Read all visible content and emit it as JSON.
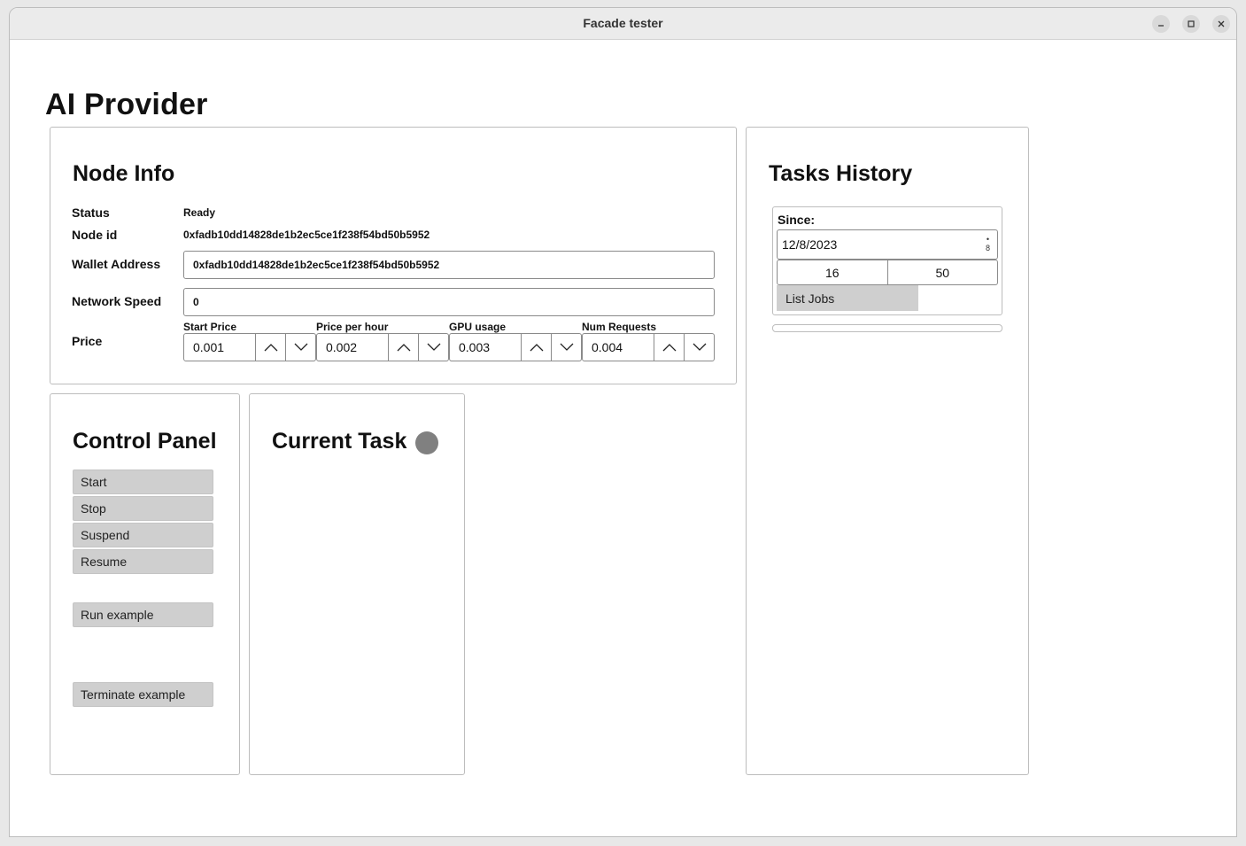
{
  "window": {
    "title": "Facade tester"
  },
  "app": {
    "title": "AI Provider"
  },
  "node_info": {
    "heading": "Node Info",
    "status_label": "Status",
    "status_value": "Ready",
    "node_id_label": "Node id",
    "node_id_value": "0xfadb10dd14828de1b2ec5ce1f238f54bd50b5952",
    "wallet_label": "Wallet Address",
    "wallet_value": "0xfadb10dd14828de1b2ec5ce1f238f54bd50b5952",
    "network_label": "Network Speed",
    "network_value": "0",
    "price_label": "Price",
    "prices": [
      {
        "label": "Start Price",
        "value": "0.001"
      },
      {
        "label": "Price per hour",
        "value": "0.002"
      },
      {
        "label": "GPU usage",
        "value": "0.003"
      },
      {
        "label": "Num Requests",
        "value": "0.004"
      }
    ]
  },
  "control_panel": {
    "heading": "Control Panel",
    "start": "Start",
    "stop": "Stop",
    "suspend": "Suspend",
    "resume": "Resume",
    "run_example": "Run example",
    "terminate_example": "Terminate example"
  },
  "current_task": {
    "heading": "Current Task",
    "indicator_color": "#808080"
  },
  "tasks_history": {
    "heading": "Tasks History",
    "since_label": "Since:",
    "date": "12/8/2023",
    "date_spin_value": "8",
    "hour": "16",
    "minute": "50",
    "list_jobs": "List Jobs"
  }
}
